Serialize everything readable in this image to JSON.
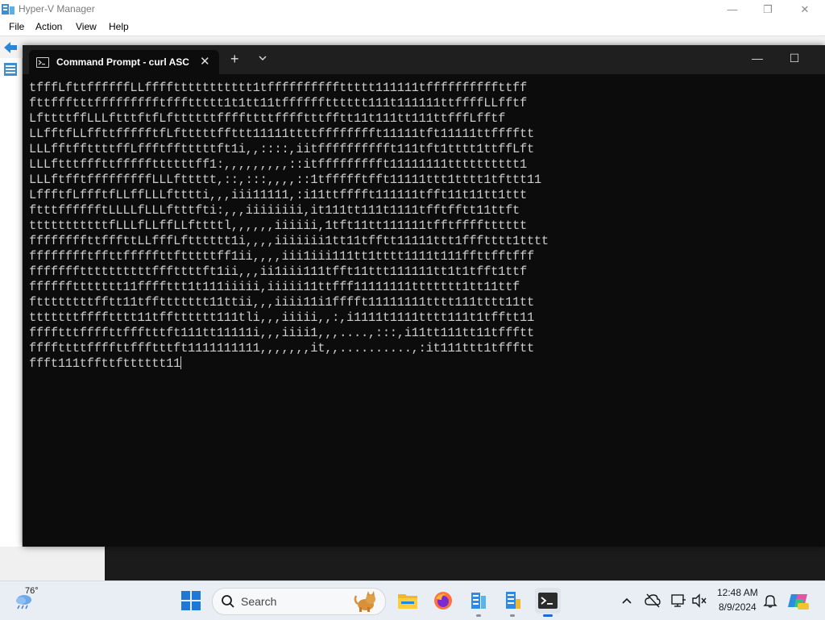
{
  "hyperv": {
    "title": "Hyper-V Manager",
    "menu": [
      "File",
      "Action",
      "View",
      "Help"
    ],
    "controls": {
      "minimize": "—",
      "restore": "❐",
      "close": "✕"
    }
  },
  "terminal": {
    "tab_title": "Command Prompt - curl  ASC",
    "tab_close": "✕",
    "new_tab": "+",
    "controls": {
      "minimize": "—",
      "maximize": "☐"
    },
    "lines": [
      "tfffLfttffffffLLffffttttttttttt1tffffffffffttttt111111tffffffffffttff",
      "fttffftttffffffffftfffttttt1t1tt11tfffffftttttt111t111111ttffffLLfftf",
      "LfttttffLLLftttftfLfttttttffffttttfffftttfftt11t111tt111ttfffLfftf",
      "LLfftfLLffttffffftfLftttttffttt11111ttttfffffffft11111tft11111ttfffftt",
      "LLLfftffttttffLffftfftttttft1i,,::::,iitfffffffffft111tft1tttt1ttffLft",
      "LLLftttfffttfffffttttttff1:,,,,,,,,,::itffffffffft11111111tttttttttt1",
      "LLLftfftfffffffffLLLfttttt,::,:::,,,,::1tffffftfft11111ttt1tttt1tfttt11",
      "LffftfLffftfLLffLLLftttti,,,iii11111,:i11ttfffft111111tfft11t11tt1ttt",
      "ftttfffffftLLLLfLLLftttfti:,,,iiiiiiii,it111tt111t1111tfftfftt11ttft",
      "tttttttttttfLLLfLLffLLfttttl,,,,,,iiiiii,1tft11tt111111tfftfffftttttt",
      "ffffffffttfffttLLfffLftttttt1i,,,,iiiiiii1tt11tfftt11111ttt1ffftttt1tttt",
      "fffffffftffttfffffttftttttff1ii,,,,iii1iii111tt1tttt1111t111ffttfftfff",
      "fffffffttttttttttfffttttft1ii,,,ii1iii111tfft11ttt111111tt1t1tfft1ttf",
      "ffffffttttttt11ffffttt1t111iiiii,iiiii11ttfff11111111ttttttt1tt11ttf",
      "fttttttttfftt11tffttttttt11ttii,,,iiii11i1fffft11111111tttt111tttt11tt",
      "tttttttfffftttt11tfftttttt111tli,,,iiiii,,:,i1111t1111tttt111t1tfftt11",
      "fffftttffffttffftttft111tt11111i,,,iiii1,,,....,:::,i11tt111tt11tffftt",
      "ffffttttffffttffftttft1111111111,,,,,,,it,,..........,:it111ttt1tffftt",
      "ffft111tffttftttttt11"
    ]
  },
  "taskbar": {
    "weather_temp": "76°",
    "search_placeholder": "Search",
    "clock_time": "12:48 AM",
    "clock_date": "8/9/2024",
    "apps": [
      "file-explorer",
      "firefox",
      "hyper-v-app-1",
      "hyper-v-app-2",
      "terminal"
    ],
    "tray_icons": [
      "chevron-up-icon",
      "cloud-off-icon",
      "monitor-icon",
      "speaker-muted-icon",
      "bell-icon",
      "copilot-icon"
    ]
  }
}
